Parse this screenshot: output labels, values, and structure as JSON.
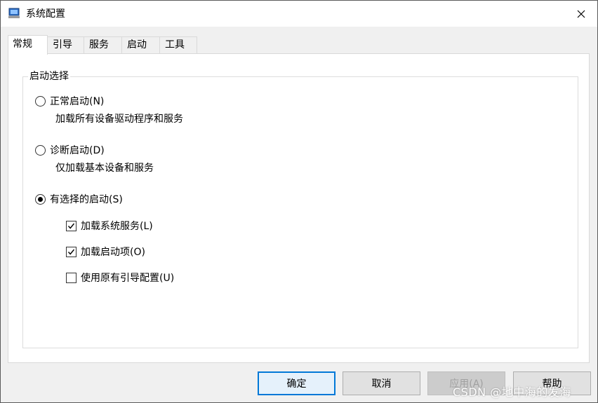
{
  "window": {
    "title": "系统配置",
    "close_icon": "close-icon",
    "app_icon": "system-config-icon"
  },
  "tabs": [
    {
      "label": "常规",
      "active": true
    },
    {
      "label": "引导",
      "active": false
    },
    {
      "label": "服务",
      "active": false
    },
    {
      "label": "启动",
      "active": false
    },
    {
      "label": "工具",
      "active": false
    }
  ],
  "startup": {
    "group_title": "启动选择",
    "options": [
      {
        "label": "正常启动(N)",
        "description": "加载所有设备驱动程序和服务",
        "selected": false
      },
      {
        "label": "诊断启动(D)",
        "description": "仅加载基本设备和服务",
        "selected": false
      },
      {
        "label": "有选择的启动(S)",
        "selected": true
      }
    ],
    "selective": [
      {
        "label": "加载系统服务(L)",
        "checked": true
      },
      {
        "label": "加载启动项(O)",
        "checked": true
      },
      {
        "label": "使用原有引导配置(U)",
        "checked": false
      }
    ]
  },
  "buttons": {
    "ok": "确定",
    "cancel": "取消",
    "apply": "应用(A)",
    "help": "帮助"
  },
  "watermark": "CSDN @地中海的发海",
  "colors": {
    "accent": "#0078d7",
    "window_bg": "#f0f0f0",
    "panel_bg": "#ffffff"
  }
}
